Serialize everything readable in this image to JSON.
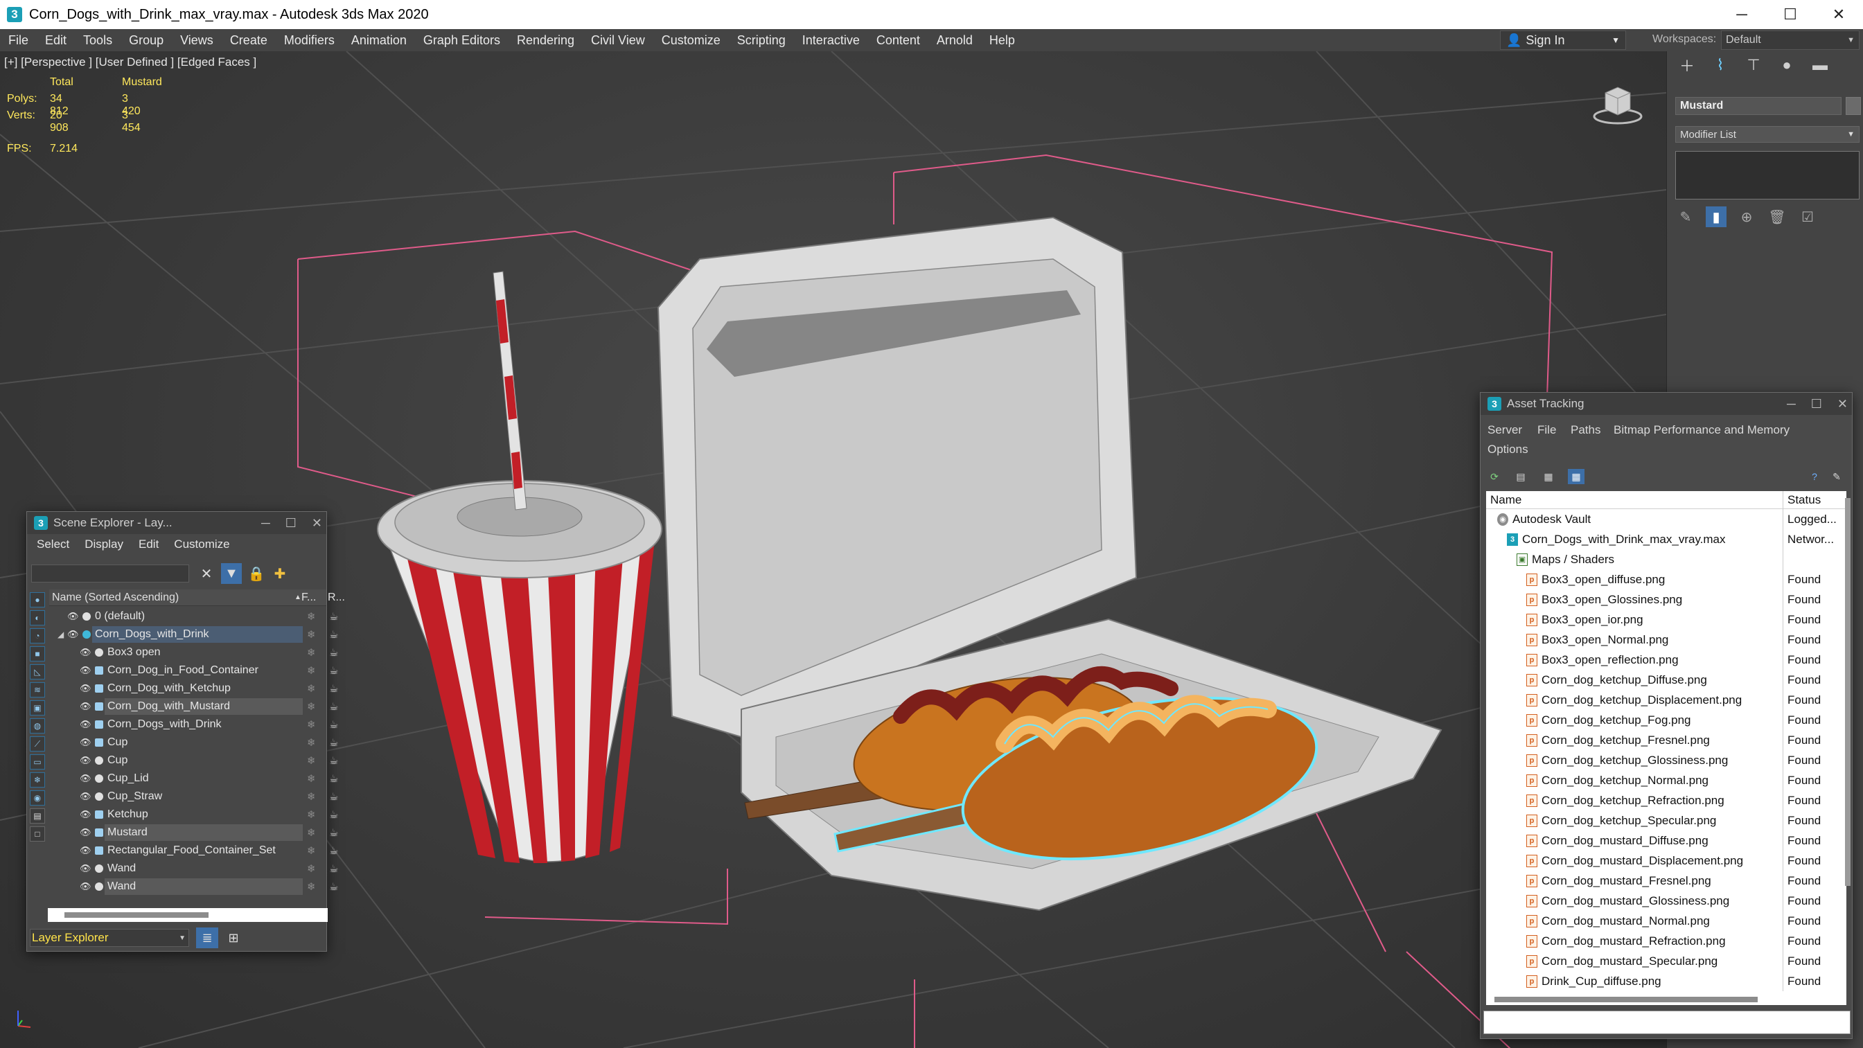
{
  "window": {
    "title": "Corn_Dogs_with_Drink_max_vray.max - Autodesk 3ds Max 2020",
    "app_icon": "3",
    "controls": [
      "minimize-icon",
      "maximize-icon",
      "close-icon"
    ],
    "minimize_glyph": "─",
    "maximize_glyph": "☐",
    "close_glyph": "✕"
  },
  "menubar": {
    "items": [
      "File",
      "Edit",
      "Tools",
      "Group",
      "Views",
      "Create",
      "Modifiers",
      "Animation",
      "Graph Editors",
      "Rendering",
      "Civil View",
      "Customize",
      "Scripting",
      "Interactive",
      "Content",
      "Arnold",
      "Help"
    ],
    "signin_label": "Sign In",
    "workspaces_label": "Workspaces:",
    "workspaces_value": "Default"
  },
  "viewport": {
    "label": "[+] [Perspective ] [User Defined ] [Edged Faces ]",
    "stats": {
      "col_total": "Total",
      "col_selected": "Mustard",
      "polys_label": "Polys:",
      "polys_total": "34 812",
      "polys_selected": "3 420",
      "verts_label": "Verts:",
      "verts_total": "20 908",
      "verts_selected": "3 454",
      "fps_label": "FPS:",
      "fps_value": "7.214"
    }
  },
  "command_panel": {
    "object_name": "Mustard",
    "modifier_list": "Modifier List"
  },
  "scene_explorer": {
    "title": "Scene Explorer - Lay...",
    "menu": [
      "Select",
      "Display",
      "Edit",
      "Customize"
    ],
    "header_name": "Name (Sorted Ascending)",
    "header_frozen": "F...",
    "header_render": "R...",
    "rows": [
      {
        "name": "0 (default)",
        "indent": 0,
        "type": "layer"
      },
      {
        "name": "Corn_Dogs_with_Drink",
        "indent": 0,
        "type": "layer-active"
      },
      {
        "name": "Box3 open",
        "indent": 1,
        "type": "object"
      },
      {
        "name": "Corn_Dog_in_Food_Container",
        "indent": 1,
        "type": "group"
      },
      {
        "name": "Corn_Dog_with_Ketchup",
        "indent": 1,
        "type": "group"
      },
      {
        "name": "Corn_Dog_with_Mustard",
        "indent": 1,
        "type": "group-sel"
      },
      {
        "name": "Corn_Dogs_with_Drink",
        "indent": 1,
        "type": "group"
      },
      {
        "name": "Cup",
        "indent": 1,
        "type": "group"
      },
      {
        "name": "Cup",
        "indent": 1,
        "type": "object"
      },
      {
        "name": "Cup_Lid",
        "indent": 1,
        "type": "object"
      },
      {
        "name": "Cup_Straw",
        "indent": 1,
        "type": "object"
      },
      {
        "name": "Ketchup",
        "indent": 1,
        "type": "group"
      },
      {
        "name": "Mustard",
        "indent": 1,
        "type": "group-sel"
      },
      {
        "name": "Rectangular_Food_Container_Set",
        "indent": 1,
        "type": "group"
      },
      {
        "name": "Wand",
        "indent": 1,
        "type": "object"
      },
      {
        "name": "Wand",
        "indent": 1,
        "type": "object-sel"
      }
    ],
    "bottom_label": "Layer Explorer"
  },
  "asset_tracking": {
    "title": "Asset Tracking",
    "menu": [
      "Server",
      "File",
      "Paths",
      "Bitmap Performance and Memory",
      "Options"
    ],
    "col_name": "Name",
    "col_status": "Status",
    "rows": [
      {
        "name": "Autodesk Vault",
        "status": "Logged...",
        "indent": 0,
        "icon": "vault"
      },
      {
        "name": "Corn_Dogs_with_Drink_max_vray.max",
        "status": "Networ...",
        "indent": 1,
        "icon": "max"
      },
      {
        "name": "Maps / Shaders",
        "status": "",
        "indent": 2,
        "icon": "folder"
      },
      {
        "name": "Box3_open_diffuse.png",
        "status": "Found",
        "indent": 3,
        "icon": "png"
      },
      {
        "name": "Box3_open_Glossines.png",
        "status": "Found",
        "indent": 3,
        "icon": "png"
      },
      {
        "name": "Box3_open_ior.png",
        "status": "Found",
        "indent": 3,
        "icon": "png"
      },
      {
        "name": "Box3_open_Normal.png",
        "status": "Found",
        "indent": 3,
        "icon": "png"
      },
      {
        "name": "Box3_open_reflection.png",
        "status": "Found",
        "indent": 3,
        "icon": "png"
      },
      {
        "name": "Corn_dog_ketchup_Diffuse.png",
        "status": "Found",
        "indent": 3,
        "icon": "png"
      },
      {
        "name": "Corn_dog_ketchup_Displacement.png",
        "status": "Found",
        "indent": 3,
        "icon": "png"
      },
      {
        "name": "Corn_dog_ketchup_Fog.png",
        "status": "Found",
        "indent": 3,
        "icon": "png"
      },
      {
        "name": "Corn_dog_ketchup_Fresnel.png",
        "status": "Found",
        "indent": 3,
        "icon": "png"
      },
      {
        "name": "Corn_dog_ketchup_Glossiness.png",
        "status": "Found",
        "indent": 3,
        "icon": "png"
      },
      {
        "name": "Corn_dog_ketchup_Normal.png",
        "status": "Found",
        "indent": 3,
        "icon": "png"
      },
      {
        "name": "Corn_dog_ketchup_Refraction.png",
        "status": "Found",
        "indent": 3,
        "icon": "png"
      },
      {
        "name": "Corn_dog_ketchup_Specular.png",
        "status": "Found",
        "indent": 3,
        "icon": "png"
      },
      {
        "name": "Corn_dog_mustard_Diffuse.png",
        "status": "Found",
        "indent": 3,
        "icon": "png"
      },
      {
        "name": "Corn_dog_mustard_Displacement.png",
        "status": "Found",
        "indent": 3,
        "icon": "png"
      },
      {
        "name": "Corn_dog_mustard_Fresnel.png",
        "status": "Found",
        "indent": 3,
        "icon": "png"
      },
      {
        "name": "Corn_dog_mustard_Glossiness.png",
        "status": "Found",
        "indent": 3,
        "icon": "png"
      },
      {
        "name": "Corn_dog_mustard_Normal.png",
        "status": "Found",
        "indent": 3,
        "icon": "png"
      },
      {
        "name": "Corn_dog_mustard_Refraction.png",
        "status": "Found",
        "indent": 3,
        "icon": "png"
      },
      {
        "name": "Corn_dog_mustard_Specular.png",
        "status": "Found",
        "indent": 3,
        "icon": "png"
      },
      {
        "name": "Drink_Cup_diffuse.png",
        "status": "Found",
        "indent": 3,
        "icon": "png"
      }
    ]
  },
  "colors": {
    "ui_dark": "#444444",
    "viewport_bg": "#3a3a3a",
    "stats_yellow": "#ffe85c",
    "selection_cyan": "#6fe8ff",
    "bbox_pink": "#e05b8a",
    "layer_explorer_yellow": "#ffe34a"
  }
}
